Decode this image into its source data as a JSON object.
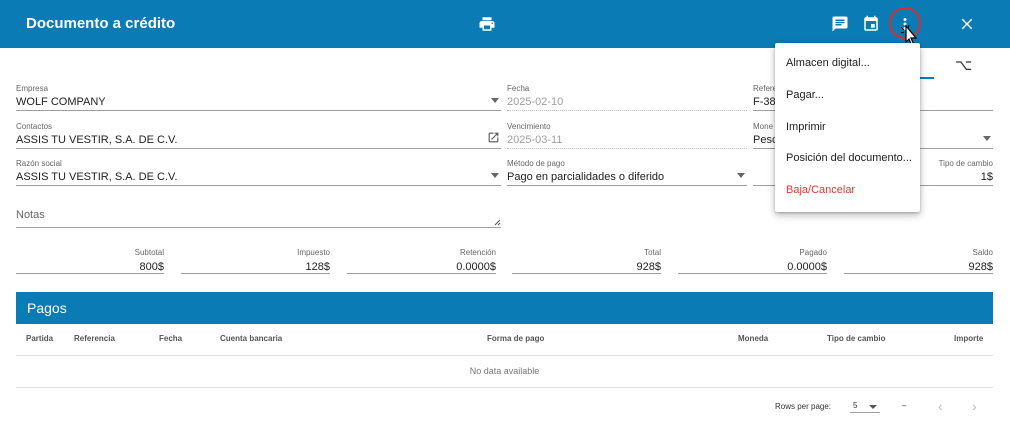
{
  "header": {
    "title": "Documento a crédito",
    "icons": [
      "printer-icon",
      "comment-icon",
      "calendar-icon",
      "more-vert-icon",
      "close-icon"
    ],
    "accent": "#0a7bb4"
  },
  "tabs_icon": "⌥",
  "form": {
    "empresa": {
      "label": "Empresa",
      "value": "WOLF COMPANY"
    },
    "fecha": {
      "label": "Fecha",
      "value": "2025-02-10"
    },
    "referencia": {
      "label": "Refere",
      "value": "F-38"
    },
    "contactos": {
      "label": "Contactos",
      "value": "ASSIS TU VESTIR, S.A. DE C.V."
    },
    "vencimiento": {
      "label": "Vencimiento",
      "value": "2025-03-11"
    },
    "moneda": {
      "label": "Mone",
      "value": "Pesc"
    },
    "razon_social": {
      "label": "Razón social",
      "value": "ASSIS TU VESTIR, S.A. DE C.V."
    },
    "metodo_pago": {
      "label": "Método de pago",
      "value": "Pago en parcialidades o diferido"
    },
    "tipo_cambio": {
      "label": "Tipo de cambio",
      "value": "1$"
    },
    "notas": {
      "placeholder": "Notas"
    }
  },
  "totals": [
    {
      "label": "Subtotal",
      "value": "800$"
    },
    {
      "label": "Impuesto",
      "value": "128$"
    },
    {
      "label": "Retención",
      "value": "0.0000$"
    },
    {
      "label": "Total",
      "value": "928$"
    },
    {
      "label": "Pagado",
      "value": "0.0000$"
    },
    {
      "label": "Saldo",
      "value": "928$"
    }
  ],
  "pagos": {
    "title": "Pagos",
    "columns": [
      "Partida",
      "Referencia",
      "Fecha",
      "Cuenta bancaria",
      "Forma de pago",
      "Moneda",
      "Tipo de cambio",
      "Importe"
    ],
    "empty_text": "No data available",
    "rows_per_page_label": "Rows per page:",
    "rows_per_page_value": "5",
    "range_text": "–"
  },
  "menu": {
    "items": [
      "Almacen digital...",
      "Pagar...",
      "Imprimir",
      "Posición del documento...",
      "Baja/Cancelar"
    ],
    "danger_color": "#e53935"
  }
}
